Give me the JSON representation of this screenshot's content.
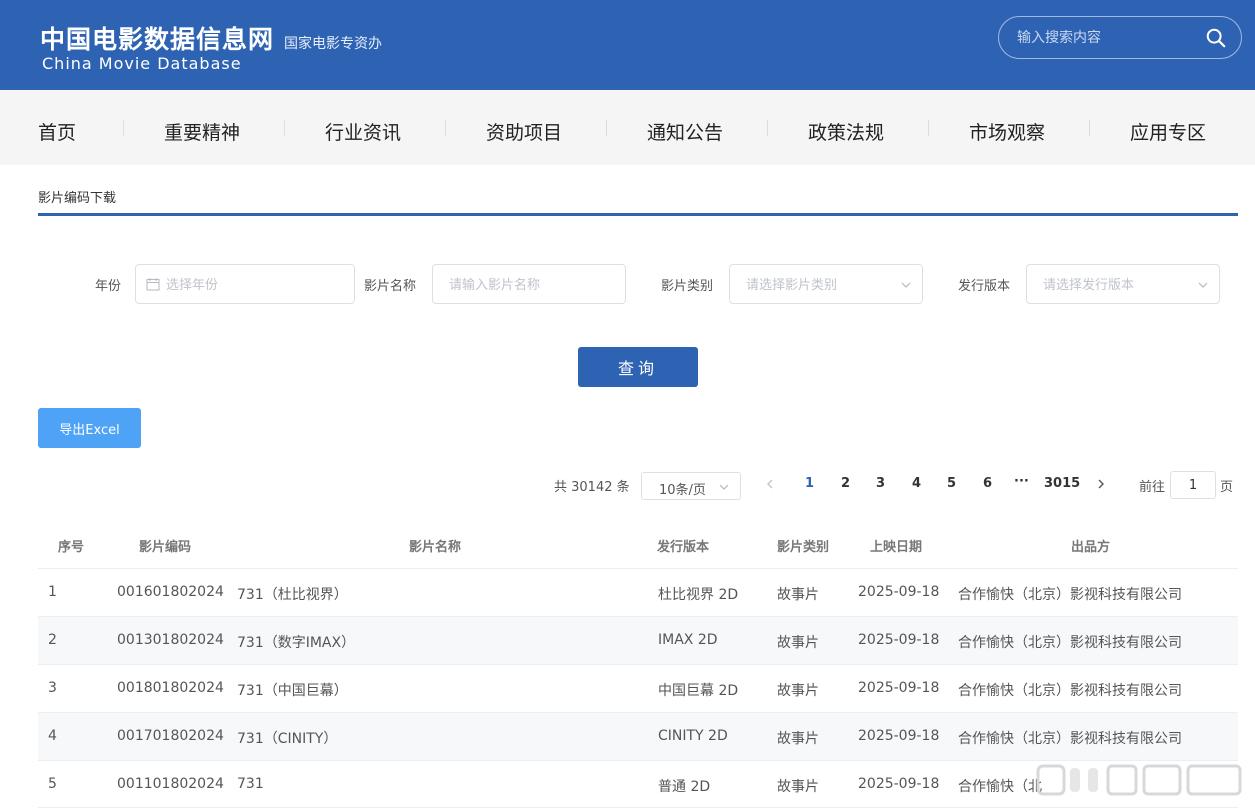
{
  "header": {
    "logo_cn": "中国电影数据信息网",
    "logo_en": "China Movie Database",
    "logo_sub": "国家电影专资办",
    "search_placeholder": "输入搜索内容"
  },
  "nav": {
    "items": [
      "首页",
      "重要精神",
      "行业资讯",
      "资助项目",
      "通知公告",
      "政策法规",
      "市场观察",
      "应用专区"
    ]
  },
  "breadcrumb": "影片编码下载",
  "filters": {
    "year_label": "年份",
    "year_placeholder": "选择年份",
    "name_label": "影片名称",
    "name_placeholder": "请输入影片名称",
    "type_label": "影片类别",
    "type_placeholder": "请选择影片类别",
    "version_label": "发行版本",
    "version_placeholder": "请选择发行版本",
    "query_label": "查询",
    "export_label": "导出Excel"
  },
  "pagination": {
    "total": "共 30142 条",
    "page_size": "10条/页",
    "pages": [
      "1",
      "2",
      "3",
      "4",
      "5",
      "6"
    ],
    "ellipsis": "···",
    "last_page": "3015",
    "goto_label": "前往",
    "goto_value": "1",
    "page_unit": "页"
  },
  "table": {
    "headers": [
      "序号",
      "影片编码",
      "影片名称",
      "发行版本",
      "影片类别",
      "上映日期",
      "出品方"
    ],
    "rows": [
      [
        "1",
        "001601802024",
        "731（杜比视界）",
        "杜比视界 2D",
        "故事片",
        "2025-09-18",
        "合作愉快（北京）影视科技有限公司"
      ],
      [
        "2",
        "001301802024",
        "731（数字IMAX）",
        "IMAX 2D",
        "故事片",
        "2025-09-18",
        "合作愉快（北京）影视科技有限公司"
      ],
      [
        "3",
        "001801802024",
        "731（中国巨幕）",
        "中国巨幕 2D",
        "故事片",
        "2025-09-18",
        "合作愉快（北京）影视科技有限公司"
      ],
      [
        "4",
        "001701802024",
        "731（CINITY）",
        "CINITY 2D",
        "故事片",
        "2025-09-18",
        "合作愉快（北京）影视科技有限公司"
      ],
      [
        "5",
        "001101802024",
        "731",
        "普通 2D",
        "故事片",
        "2025-09-18",
        "合作愉快（北"
      ]
    ]
  },
  "colors": {
    "brand": "#2e63b3",
    "export": "#4fa3f7"
  }
}
